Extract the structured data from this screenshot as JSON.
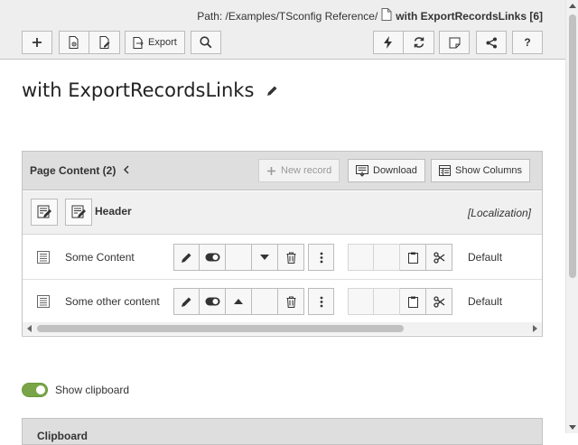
{
  "path": {
    "label": "Path: /Examples/TSconfig Reference/",
    "page_title": "with ExportRecordsLinks [6]",
    "page_icon": "page-icon"
  },
  "toolbar": {
    "export_label": "Export",
    "help_label": "?"
  },
  "page": {
    "title": "with ExportRecordsLinks"
  },
  "content_panel": {
    "title": "Page Content (2)",
    "new_record_label": "New record",
    "download_label": "Download",
    "show_columns_label": "Show Columns",
    "header_label": "Header",
    "localization_label": "[Localization]",
    "rows": [
      {
        "label": "Some Content",
        "language": "Default"
      },
      {
        "label": "Some other content",
        "language": "Default"
      }
    ]
  },
  "clipboard": {
    "toggle_label": "Show clipboard",
    "toggle_on": true,
    "panel_title": "Clipboard"
  },
  "colors": {
    "header_bg": "#eeeeee",
    "panel_head_bg": "#dedede",
    "toggle_on": "#79a548"
  }
}
